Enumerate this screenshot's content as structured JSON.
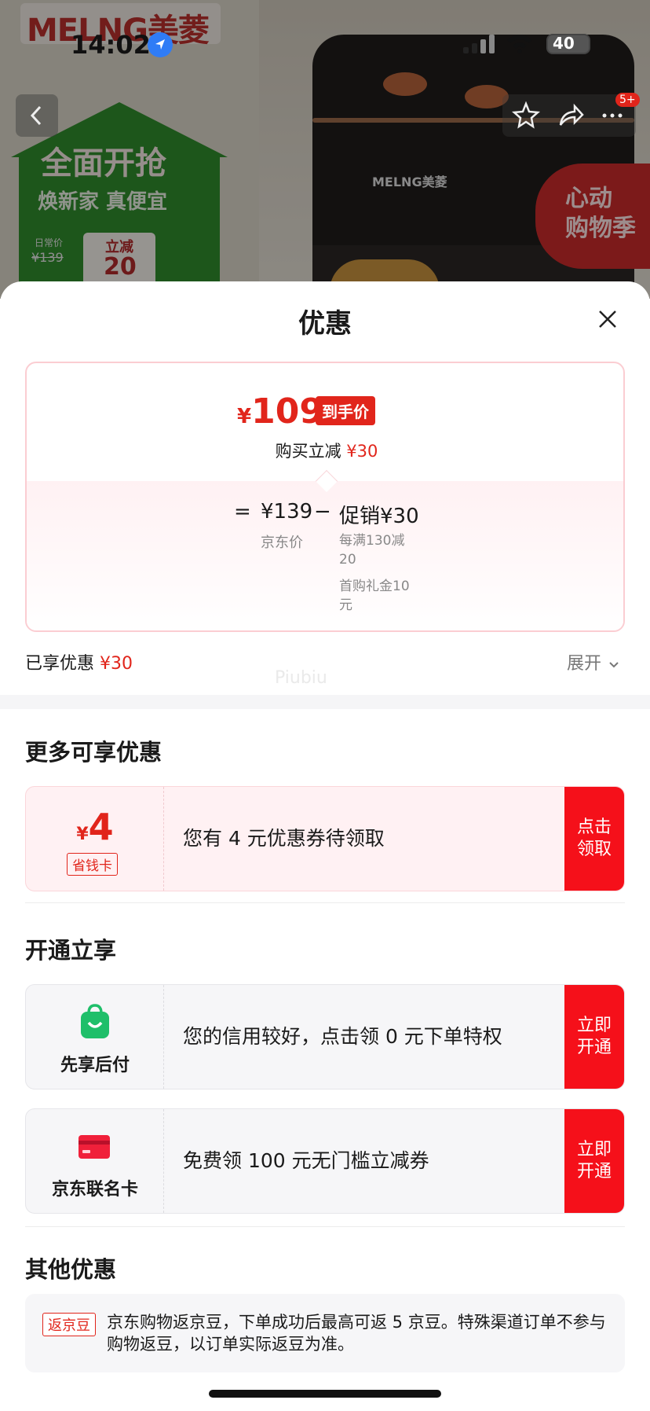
{
  "background": {
    "brand_logo": "MELNG美菱",
    "promo_title": "全面开抢",
    "promo_subtitle": "焕新家 真便宜",
    "daily_price_label": "日常价",
    "daily_price": "¥139",
    "instant_cut_label": "立减",
    "instant_cut_value": "20",
    "product_brand": "MELNG美菱",
    "promo_badge": "心动\n购物季"
  },
  "status_bar": {
    "time": "14:02",
    "battery": "40"
  },
  "nav": {
    "cart_badge": "5+"
  },
  "sheet": {
    "title": "优惠",
    "price_card": {
      "currency": "¥",
      "final_price": "109",
      "final_tag": "到手价",
      "reduce_label": "购买立减",
      "reduce_value": "¥30",
      "equals": "=",
      "jd_price": "¥139",
      "minus": "−",
      "promo_label": "促销¥30",
      "jd_price_label": "京东价",
      "promo_detail_1": "每满130减20",
      "promo_detail_2": "首购礼金10元"
    },
    "enjoyed_label": "已享优惠",
    "enjoyed_value": "¥30",
    "expand_label": "展开",
    "watermark": "Piubiu",
    "more_offers_title": "更多可享优惠",
    "coupon": {
      "currency": "¥",
      "value": "4",
      "tag": "省钱卡",
      "text": "您有 4 元优惠券待领取",
      "button": "点击领取"
    },
    "activate_title": "开通立享",
    "pay_later": {
      "label": "先享后付",
      "text": "您的信用较好，点击领 0 元下单特权",
      "button": "立即开通"
    },
    "jd_card": {
      "label": "京东联名卡",
      "text": "免费领 100 元无门槛立减券",
      "button": "立即开通"
    },
    "other_title": "其他优惠",
    "other": {
      "tag": "返京豆",
      "text": "京东购物返京豆，下单成功后最高可返 5 京豆。特殊渠道订单不参与购物返豆，以订单实际返豆为准。"
    }
  },
  "colors": {
    "accent": "#e1251b",
    "button_red": "#f5101a",
    "pink_bg": "#fff1f3"
  },
  "icons": [
    "location-arrow-icon",
    "signal-icon",
    "wifi-icon",
    "battery-icon",
    "back-icon",
    "star-icon",
    "share-icon",
    "more-icon",
    "close-icon",
    "chevron-down-icon",
    "shopping-bag-icon",
    "credit-card-icon"
  ]
}
